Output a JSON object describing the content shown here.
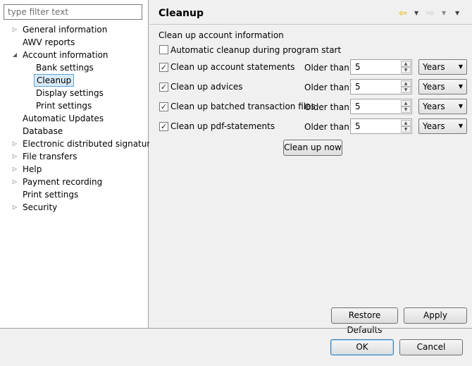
{
  "filter": {
    "placeholder": "type filter text"
  },
  "tree": [
    {
      "label": "General information",
      "arrow": "▷",
      "level": 0
    },
    {
      "label": "AWV reports",
      "arrow": "",
      "level": 0
    },
    {
      "label": "Account information",
      "arrow": "◢",
      "level": 0
    },
    {
      "label": "Bank settings",
      "arrow": "",
      "level": 1
    },
    {
      "label": "Cleanup",
      "arrow": "",
      "level": 1,
      "selected": true
    },
    {
      "label": "Display settings",
      "arrow": "",
      "level": 1
    },
    {
      "label": "Print settings",
      "arrow": "",
      "level": 1
    },
    {
      "label": "Automatic Updates",
      "arrow": "",
      "level": 0
    },
    {
      "label": "Database",
      "arrow": "",
      "level": 0
    },
    {
      "label": "Electronic distributed signature",
      "arrow": "▷",
      "level": 0
    },
    {
      "label": "File transfers",
      "arrow": "▷",
      "level": 0
    },
    {
      "label": "Help",
      "arrow": "▷",
      "level": 0
    },
    {
      "label": "Payment recording",
      "arrow": "▷",
      "level": 0
    },
    {
      "label": "Print settings",
      "arrow": "",
      "level": 0
    },
    {
      "label": "Security",
      "arrow": "▷",
      "level": 0
    }
  ],
  "page": {
    "title": "Cleanup",
    "group_title": "Clean up account information",
    "auto_cleanup": {
      "label": "Automatic cleanup during program start",
      "checked": false
    },
    "rows": [
      {
        "label": "Clean up account statements",
        "checked": true,
        "older_label": "Older than",
        "value": "5",
        "unit": "Years"
      },
      {
        "label": "Clean up advices",
        "checked": true,
        "older_label": "Older than",
        "value": "5",
        "unit": "Years"
      },
      {
        "label": "Clean up batched transaction files",
        "checked": true,
        "older_label": "Older than",
        "value": "5",
        "unit": "Years"
      },
      {
        "label": "Clean up pdf-statements",
        "checked": true,
        "older_label": "Older than",
        "value": "5",
        "unit": "Years"
      }
    ],
    "clean_now": "Clean up now",
    "restore_defaults": "Restore Defaults",
    "apply": "Apply"
  },
  "nav": {
    "back_icon": "arrow-left-icon",
    "forward_icon": "arrow-right-icon",
    "back_color": "#e8b400",
    "forward_color": "#c8c8c8"
  },
  "dialog": {
    "ok": "OK",
    "cancel": "Cancel"
  }
}
